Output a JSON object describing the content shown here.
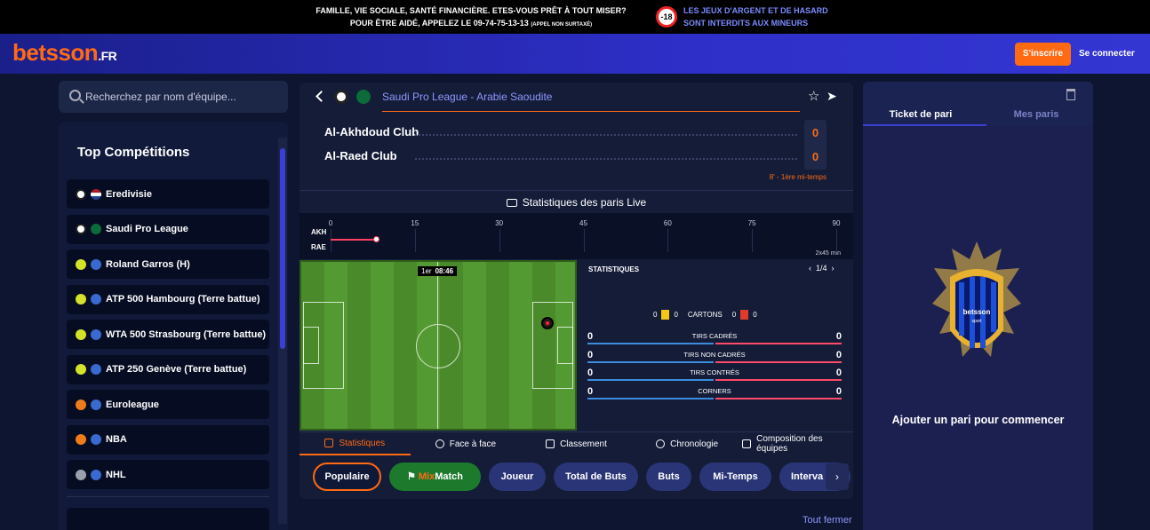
{
  "warning": {
    "line1": "FAMILLE, VIE SOCIALE, SANTÉ FINANCIÈRE. ETES-VOUS PRÊT À TOUT MISER?",
    "line2": "POUR ÊTRE AIDÉ, APPELEZ LE 09-74-75-13-13",
    "line2_small": "(APPEL NON SURTAXÉ)",
    "age": "-18",
    "right1": "LES JEUX D'ARGENT ET DE HASARD",
    "right2": "SONT INTERDITS AUX MINEURS"
  },
  "header": {
    "logo": "betsson",
    "logo_suffix": ".FR",
    "signup": "S'inscrire",
    "login": "Se connecter"
  },
  "search": {
    "placeholder": "Recherchez par nom d'équipe..."
  },
  "competitions": {
    "title": "Top Compétitions",
    "items": [
      {
        "label": "Eredivisie",
        "icon": "football-icon",
        "flag": "netherlands-flag-icon"
      },
      {
        "label": "Saudi Pro League",
        "icon": "football-icon",
        "flag": "saudi-flag-icon"
      },
      {
        "label": "Roland Garros (H)",
        "icon": "tennis-icon",
        "flag": "world-icon"
      },
      {
        "label": "ATP 500 Hambourg (Terre battue)",
        "icon": "tennis-icon",
        "flag": "world-icon"
      },
      {
        "label": "WTA 500 Strasbourg (Terre battue)",
        "icon": "tennis-icon",
        "flag": "world-icon"
      },
      {
        "label": "ATP 250 Genève (Terre battue)",
        "icon": "tennis-icon",
        "flag": "world-icon"
      },
      {
        "label": "Euroleague",
        "icon": "basketball-icon",
        "flag": "world-icon"
      },
      {
        "label": "NBA",
        "icon": "basketball-icon",
        "flag": "world-icon"
      },
      {
        "label": "NHL",
        "icon": "hockey-icon",
        "flag": "world-icon"
      }
    ]
  },
  "match": {
    "league": "Saudi Pro League - Arabie Saoudite",
    "home": "Al-Akhdoud Club",
    "away": "Al-Raed Club",
    "home_score": "0",
    "away_score": "0",
    "minute": "8' - 1ère mi-temps",
    "live_stats_label": "Statistiques des paris Live",
    "timeline": {
      "home_abbr": "AKH",
      "away_abbr": "RAE",
      "ticks": [
        "0",
        "15",
        "30",
        "45",
        "60",
        "75",
        "90"
      ],
      "duration": "2x45 min",
      "elapsed_minutes": 8
    },
    "pitch_clock": {
      "period": "1er",
      "time": "08:46"
    },
    "stats": {
      "title": "STATISTIQUES",
      "page": "1/4",
      "cards": {
        "home_yellow": "0",
        "home_red": "0",
        "label": "CARTONS",
        "away_yellow": "0",
        "away_red": "0"
      },
      "rows": [
        {
          "label": "TIRS CADRÉS",
          "home": "0",
          "away": "0"
        },
        {
          "label": "TIRS NON CADRÉS",
          "home": "0",
          "away": "0"
        },
        {
          "label": "TIRS CONTRÉS",
          "home": "0",
          "away": "0"
        },
        {
          "label": "CORNERS",
          "home": "0",
          "away": "0"
        }
      ]
    },
    "tabs": [
      "Statistiques",
      "Face à face",
      "Classement",
      "Chronologie",
      "Composition des équipes"
    ],
    "chips": [
      "Populaire",
      "MixMatch",
      "Joueur",
      "Total de Buts",
      "Buts",
      "Mi-Temps",
      "Interva"
    ],
    "mix_prefix": "Mix",
    "mix_suffix": "Match",
    "close_all": "Tout fermer"
  },
  "betslip": {
    "tab1": "Ticket de pari",
    "tab2": "Mes paris",
    "empty": "Ajouter un pari pour commencer",
    "shirt_logo": "betsson",
    "shirt_sub": "sport"
  },
  "colors": {
    "accent": "#ff6a13",
    "brand_blue": "#2e2fc8",
    "link": "#8e97ff"
  }
}
